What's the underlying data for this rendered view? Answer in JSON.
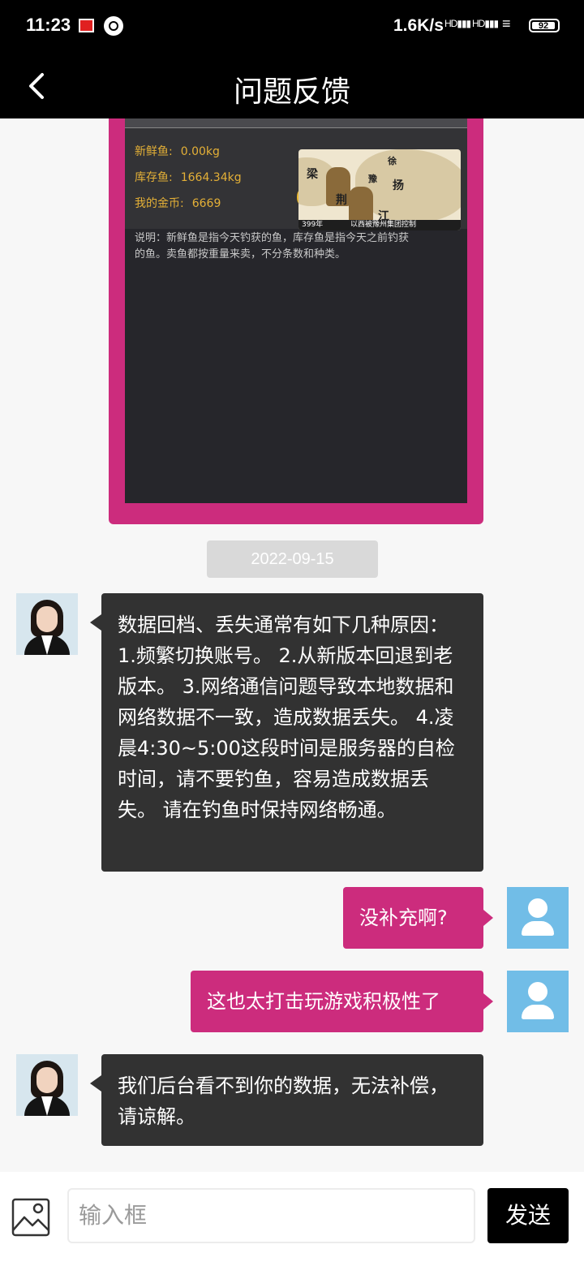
{
  "status_bar": {
    "time": "11:23",
    "net_speed": "1.6K/s",
    "signal_1": "HD",
    "signal_2": "HD",
    "battery": "92",
    "icons": [
      "news-app-icon",
      "record-icon",
      "signal-icon",
      "wifi-icon",
      "battery-icon"
    ]
  },
  "header": {
    "title": "问题反馈",
    "back_icon": "chevron-left-icon"
  },
  "attachment": {
    "stats": [
      {
        "label": "新鲜鱼:",
        "value": "0.00kg"
      },
      {
        "label": "库存鱼:",
        "value": "1664.34kg"
      },
      {
        "label": "我的金币:",
        "value": "6669"
      }
    ],
    "note_line1": "说明：新鲜鱼是指今天钓获的鱼，库存鱼是指今天之前钓获",
    "note_line2": "的鱼。卖鱼都按重量来卖，不分条数和种类。",
    "map": {
      "regions": [
        "徐",
        "梁",
        "豫",
        "扬",
        "荆",
        "江"
      ],
      "year": "399年",
      "caption": "以西被豫州集团控制"
    }
  },
  "chat": {
    "date": "2022-09-15",
    "messages": [
      {
        "from": "agent",
        "text": "数据回档、丢失通常有如下几种原因： 1.频繁切换账号。 2.从新版本回退到老版本。 3.网络通信问题导致本地数据和网络数据不一致，造成数据丢失。 4.凌晨4:30~5:00这段时间是服务器的自检时间，请不要钓鱼，容易造成数据丢失。 请在钓鱼时保持网络畅通。"
      },
      {
        "from": "user",
        "text": "没补充啊?"
      },
      {
        "from": "user",
        "text": "这也太打击玩游戏积极性了"
      },
      {
        "from": "agent",
        "text": "我们后台看不到你的数据，无法补偿，请谅解。"
      }
    ]
  },
  "composer": {
    "placeholder": "输入框",
    "send_label": "发送",
    "image_icon": "image-icon"
  },
  "colors": {
    "accent": "#cc2c7d",
    "bubble_dark": "#323232",
    "user_avatar": "#71bde7"
  }
}
